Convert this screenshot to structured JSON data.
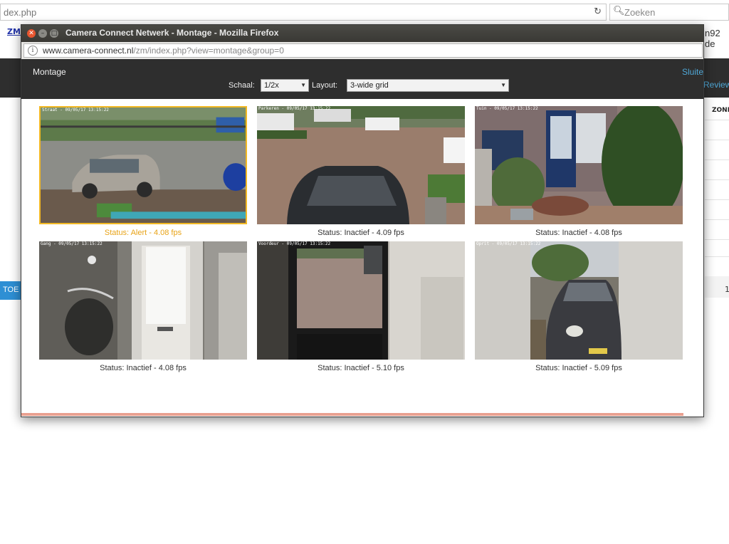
{
  "background": {
    "url_fragment": "dex.php",
    "search_placeholder": "Zoeken",
    "bookmark": "ZM",
    "bookmark_right": "n92 de",
    "review_link": "Review",
    "zone_header": "ZONE",
    "toe_button": "TOE",
    "count": "1"
  },
  "window": {
    "title": "Camera Connect Netwerk - Montage - Mozilla Firefox",
    "url_domain": "www.camera-connect.nl",
    "url_path": "/zm/index.php?view=montage&group=0"
  },
  "page": {
    "title": "Montage",
    "close_link": "Sluiten",
    "scale_label": "Schaal:",
    "scale_value": "1/2x",
    "layout_label": "Layout:",
    "layout_value": "3-wide grid"
  },
  "monitors": [
    {
      "status": "Status: Alert - 4.08 fps",
      "alert": true,
      "timestamp": "Straat - 09/05/17 13:15:22"
    },
    {
      "status": "Status: Inactief - 4.09 fps",
      "alert": false,
      "timestamp": "Parkeren - 09/05/17 13:15:22"
    },
    {
      "status": "Status: Inactief - 4.08 fps",
      "alert": false,
      "timestamp": "Tuin - 09/05/17 13:15:22"
    },
    {
      "status": "Status: Inactief - 4.08 fps",
      "alert": false,
      "timestamp": "Gang - 09/05/17 13:15:22"
    },
    {
      "status": "Status: Inactief - 5.10 fps",
      "alert": false,
      "timestamp": "Voordeur - 09/05/17 13:15:22"
    },
    {
      "status": "Status: Inactief - 5.09 fps",
      "alert": false,
      "timestamp": "Oprit - 09/05/17 13:15:22"
    }
  ],
  "colors": {
    "alert": "#f2b824",
    "link": "#4fa7d6",
    "header_bg": "#2e2e2e"
  }
}
